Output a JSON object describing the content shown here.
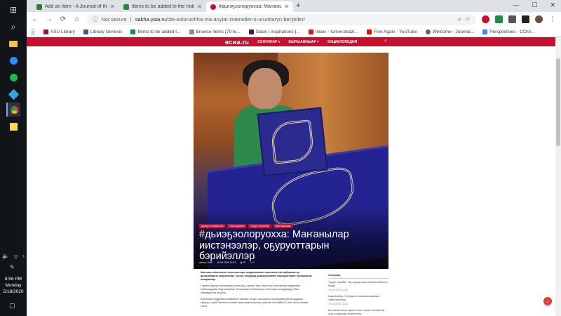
{
  "taskbar": {
    "time": "8:56 PM",
    "day": "Monday",
    "date": "5/18/2020"
  },
  "tabs": [
    {
      "title": "Add an Item - A Journal of the Plu",
      "favicon_color": "#2e7d32"
    },
    {
      "title": "Items to be added to the Indigen",
      "favicon_color": "#1e8e3e"
    },
    {
      "title": "#дьиэҕэолоруохха: Маҥанылар",
      "favicon_color": "#c8102e"
    }
  ],
  "toolbar": {
    "security_label": "Not secure",
    "url_domain": "sakha.ysia.ru",
    "url_path": "/die-eoloruohha-ma-anylar-iisteneller-o-uruottaryn-berijeller/"
  },
  "bookmarks": [
    {
      "label": "ASU Library",
      "color": "#8c1d40"
    },
    {
      "label": "Library Genesis",
      "color": "#3b5998"
    },
    {
      "label": "Items to be added t...",
      "color": "#1e8e3e"
    },
    {
      "label": "Browse Items (79 to...",
      "color": "#8c8c8c"
    },
    {
      "label": "Slack | inspirations |...",
      "color": "#4a154b"
    },
    {
      "label": "Inbox - turner.beazl...",
      "color": "#c5221f"
    },
    {
      "label": "Fine Again - YouTube",
      "color": "#ff0000"
    },
    {
      "label": "Welcome - Journal...",
      "color": "#5f6368"
    },
    {
      "label": "Perspectives - COVI...",
      "color": "#4285f4"
    }
  ],
  "site": {
    "logo": "ясиа.ru",
    "nav": [
      "СОНУННАР ▾",
      "БЫРЫАННЫАР ▾",
      "ЭНЦИКЛОПЕДИЯ"
    ]
  },
  "article": {
    "tags": [
      "Дьиэҕэ олоруоххаа",
      "Олох-дьаһах",
      "Сүрүн сонуннар",
      "Мастарыскай"
    ],
    "title": "#дьиэҕэолоруохха: Маҥанылар иистэнээлэр, оҕуруоттарын бэрийэллэр",
    "author": "Автор: ОМК",
    "date": "18.05.2020 14:21",
    "views": "35",
    "comments": "0",
    "lead": "Маҥнаас нэһилиэгин олохтоохторо пандемияннан сааптахсаттан вуйминан ар дьыалаларгы олорооллар. Уустук сиэрҕаур дьарыктананан бэрээдэктэрин туһаналлыр атаараллар.",
    "p1": "Горней улуусун Маҥнааһык олохтооҕо, аһаасс иһэ, аныгы иһэ Екатерина Андреевна Александрова Улуу Аньаһыы 75 сылыгар бэлэмнэнэр тэлегетары кэтэрдиэҕэр Уйгы сөптөөҕүттэн оҥорор.",
    "p2": "Екатерина Андреевна бэйэлээхэ таҥаһы тигэргэ холоорнуо оҥоннурбан битэр урдуһун туһугар, сорбо бэлэмтэ онлайн маастеркылаастага, участия Холтайбы 20-тан тахса таҥаһы тиктэ."
  },
  "sidebar": {
    "heading": "Сонуннар",
    "items": [
      {
        "text": "Туруус сэрийбэ: «Бу ыраҕастарга аныгын бэйэтин» наада",
        "date": "19.05.2020 13:45"
      },
      {
        "text": "Кэриэһээбэр: Ол Дьэгин Хатайыыннаабына Эмиэттиэннүүр",
        "date": "19.05.2020 13:30"
      },
      {
        "text": "Бытаанай иэбэнэ диһэ ыҥан тэрийэ ыпхайаттак сүүс ахтарылар эйэкэһиттэр",
        "date": ""
      }
    ]
  }
}
